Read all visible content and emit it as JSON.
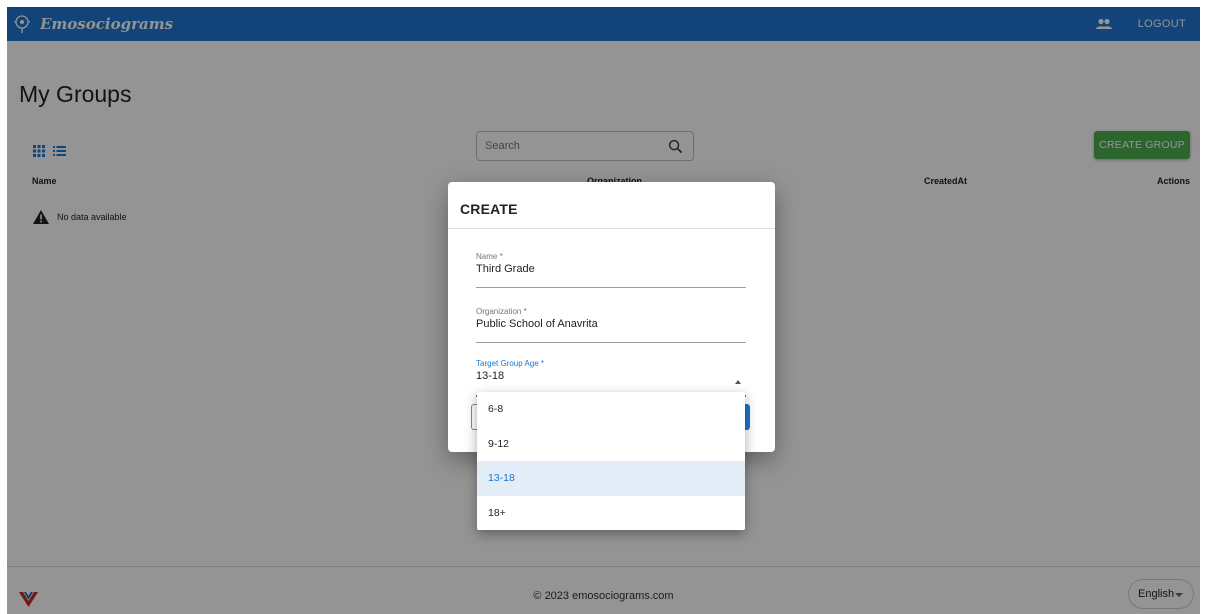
{
  "app": {
    "title": "Emosociograms"
  },
  "topbar": {
    "logout_label": "LOGOUT",
    "people_icon": "people-icon"
  },
  "page": {
    "title": "My Groups"
  },
  "toolbar": {
    "search_placeholder": "Search",
    "create_group_label": "CREATE GROUP",
    "accent_color": "#4caf50"
  },
  "table": {
    "columns": [
      "Name",
      "Organization",
      "CreatedAt",
      "Actions"
    ],
    "empty_message": "No data available"
  },
  "dialog": {
    "title": "CREATE",
    "fields": [
      {
        "label": "Name *",
        "value": "Third Grade"
      },
      {
        "label": "Organization *",
        "value": "Public School of Anavrita"
      },
      {
        "label": "Target Group Age *",
        "value": "13-18"
      }
    ],
    "age_options": [
      "6-8",
      "9-12",
      "13-18",
      "18+"
    ],
    "selected_option": "13-18"
  },
  "footer": {
    "copyright": "© 2023 emosociograms.com",
    "language": "English"
  },
  "colors": {
    "primary": "#1f74d0",
    "success": "#4caf50"
  }
}
